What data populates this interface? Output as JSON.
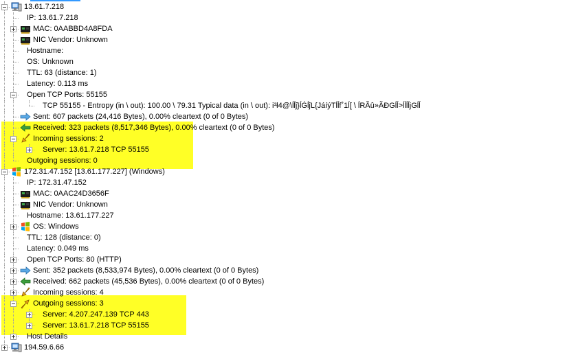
{
  "nodes": [
    {
      "level": 1,
      "exp": "minus",
      "icon": "host-computer-icon",
      "text": "13.61.7.218",
      "lastChild": false
    },
    {
      "level": 2,
      "exp": null,
      "icon": null,
      "text": "IP: 13.61.7.218",
      "lastChild": false
    },
    {
      "level": 2,
      "exp": "plus",
      "icon": "network-card-icon",
      "text": "MAC: 0AABBD4A8FDA",
      "lastChild": false
    },
    {
      "level": 2,
      "exp": null,
      "icon": "network-card-icon",
      "text": "NIC Vendor: Unknown",
      "lastChild": false
    },
    {
      "level": 2,
      "exp": null,
      "icon": null,
      "text": "Hostname:",
      "lastChild": false
    },
    {
      "level": 2,
      "exp": null,
      "icon": null,
      "text": "OS: Unknown",
      "lastChild": false
    },
    {
      "level": 2,
      "exp": null,
      "icon": null,
      "text": "TTL: 63 (distance: 1)",
      "lastChild": false
    },
    {
      "level": 2,
      "exp": null,
      "icon": null,
      "text": "Latency: 0.113 ms",
      "lastChild": false
    },
    {
      "level": 2,
      "exp": "minus",
      "icon": null,
      "text": "Open TCP Ports: 55155",
      "lastChild": false
    },
    {
      "level": 3,
      "exp": null,
      "icon": null,
      "text": "TCP 55155 - Entropy (in \\ out): 100.00 \\ 79.31 Typical data (in \\ out): i³ł4@\\ĺĺĵ}ĺĠĺĵL{JáíýTĺĺf˚1ĺ[ \\ ĺRÃû»ÃĐGĺĺ>ĺĺĺĺjGĺĺ",
      "lastChild": true
    },
    {
      "level": 2,
      "exp": null,
      "icon": "sent-arrow-icon",
      "text": "Sent: 607 packets (24,416 Bytes), 0.00% cleartext (0 of 0 Bytes)",
      "lastChild": false
    },
    {
      "level": 2,
      "exp": null,
      "icon": "received-arrow-icon",
      "text": "Received: 323 packets (8,517,346 Bytes), 0.00% cleartext (0 of 0 Bytes)",
      "lastChild": false
    },
    {
      "level": 2,
      "exp": "minus",
      "icon": "incoming-sessions-icon",
      "text": "Incoming sessions: 2",
      "lastChild": false
    },
    {
      "level": 3,
      "exp": "plus",
      "icon": null,
      "text": "Server: 13.61.7.218 TCP 55155",
      "lastChild": true
    },
    {
      "level": 2,
      "exp": null,
      "icon": null,
      "text": "Outgoing sessions: 0",
      "lastChild": true
    },
    {
      "level": 1,
      "exp": "minus",
      "icon": "windows-icon",
      "text": "172.31.47.152 [13.61.177.227] (Windows)",
      "lastChild": false
    },
    {
      "level": 2,
      "exp": null,
      "icon": null,
      "text": "IP: 172.31.47.152",
      "lastChild": false
    },
    {
      "level": 2,
      "exp": null,
      "icon": "network-card-icon",
      "text": "MAC: 0AAC24D3656F",
      "lastChild": false
    },
    {
      "level": 2,
      "exp": null,
      "icon": "network-card-icon",
      "text": "NIC Vendor: Unknown",
      "lastChild": false
    },
    {
      "level": 2,
      "exp": null,
      "icon": null,
      "text": "Hostname: 13.61.177.227",
      "lastChild": false
    },
    {
      "level": 2,
      "exp": "plus",
      "icon": "windows-icon",
      "text": "OS: Windows",
      "lastChild": false
    },
    {
      "level": 2,
      "exp": null,
      "icon": null,
      "text": "TTL: 128 (distance: 0)",
      "lastChild": false
    },
    {
      "level": 2,
      "exp": null,
      "icon": null,
      "text": "Latency: 0.049 ms",
      "lastChild": false
    },
    {
      "level": 2,
      "exp": "plus",
      "icon": null,
      "text": "Open TCP Ports: 80 (HTTP)",
      "lastChild": false
    },
    {
      "level": 2,
      "exp": "plus",
      "icon": "sent-arrow-icon",
      "text": "Sent: 352 packets (8,533,974 Bytes), 0.00% cleartext (0 of 0 Bytes)",
      "lastChild": false
    },
    {
      "level": 2,
      "exp": "plus",
      "icon": "received-arrow-icon",
      "text": "Received: 662 packets (45,536 Bytes), 0.00% cleartext (0 of 0 Bytes)",
      "lastChild": false
    },
    {
      "level": 2,
      "exp": "plus",
      "icon": "incoming-sessions-icon",
      "text": "Incoming sessions: 4",
      "lastChild": false
    },
    {
      "level": 2,
      "exp": "minus",
      "icon": "outgoing-sessions-icon",
      "text": "Outgoing sessions: 3",
      "lastChild": false
    },
    {
      "level": 3,
      "exp": "plus",
      "icon": null,
      "text": "Server: 4.207.247.139 TCP 443",
      "lastChild": false
    },
    {
      "level": 3,
      "exp": "plus",
      "icon": null,
      "text": "Server: 13.61.7.218 TCP 55155",
      "lastChild": true
    },
    {
      "level": 2,
      "exp": "plus",
      "icon": null,
      "text": "Host Details",
      "lastChild": true
    },
    {
      "level": 1,
      "exp": "plus",
      "icon": "host-computer-icon",
      "text": "194.59.6.66",
      "lastChild": true
    }
  ],
  "colors": {
    "highlight": "#ffff26",
    "selection": "#3399ff",
    "tree_line": "#a0a0a0"
  }
}
